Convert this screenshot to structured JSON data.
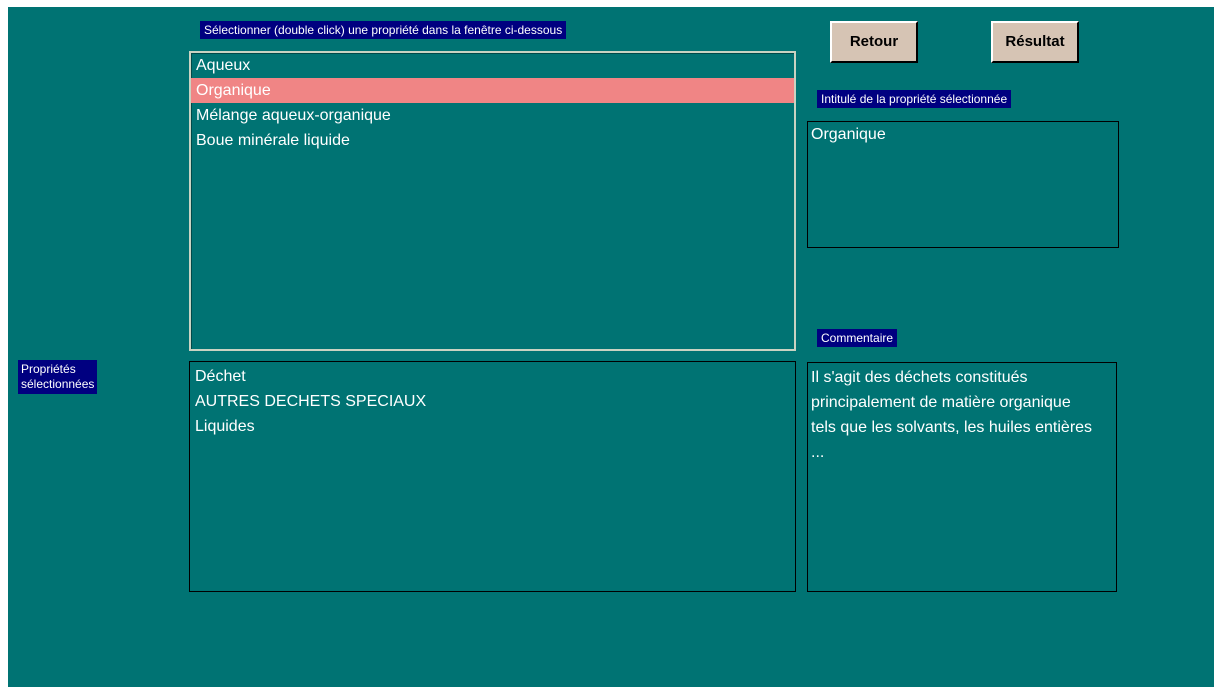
{
  "instruction_label": "Sélectionner (double click) une propriété dans la fenêtre ci-dessous",
  "buttons": {
    "retour": "Retour",
    "resultat": "Résultat"
  },
  "property_list": {
    "items": [
      {
        "label": "Aqueux"
      },
      {
        "label": "Organique"
      },
      {
        "label": "Mélange aqueux-organique"
      },
      {
        "label": "Boue minérale liquide"
      }
    ],
    "selected_index": 1
  },
  "selected_title_panel": {
    "label": "Intitulé de la propriété sélectionnée",
    "value": "Organique"
  },
  "selected_properties_panel": {
    "label_line1": "Propriétés",
    "label_line2": "sélectionnées",
    "items": [
      {
        "label": "Déchet"
      },
      {
        "label": "AUTRES DECHETS SPECIAUX"
      },
      {
        "label": "Liquides"
      }
    ]
  },
  "comment_panel": {
    "label": "Commentaire",
    "text": "Il s'agit des déchets constitués principalement de matière organique tels que les solvants, les huiles entières ..."
  },
  "colors": {
    "background": "#007373",
    "label_background": "#000080",
    "selection": "#f08585",
    "button_face": "#d6c4b4"
  }
}
